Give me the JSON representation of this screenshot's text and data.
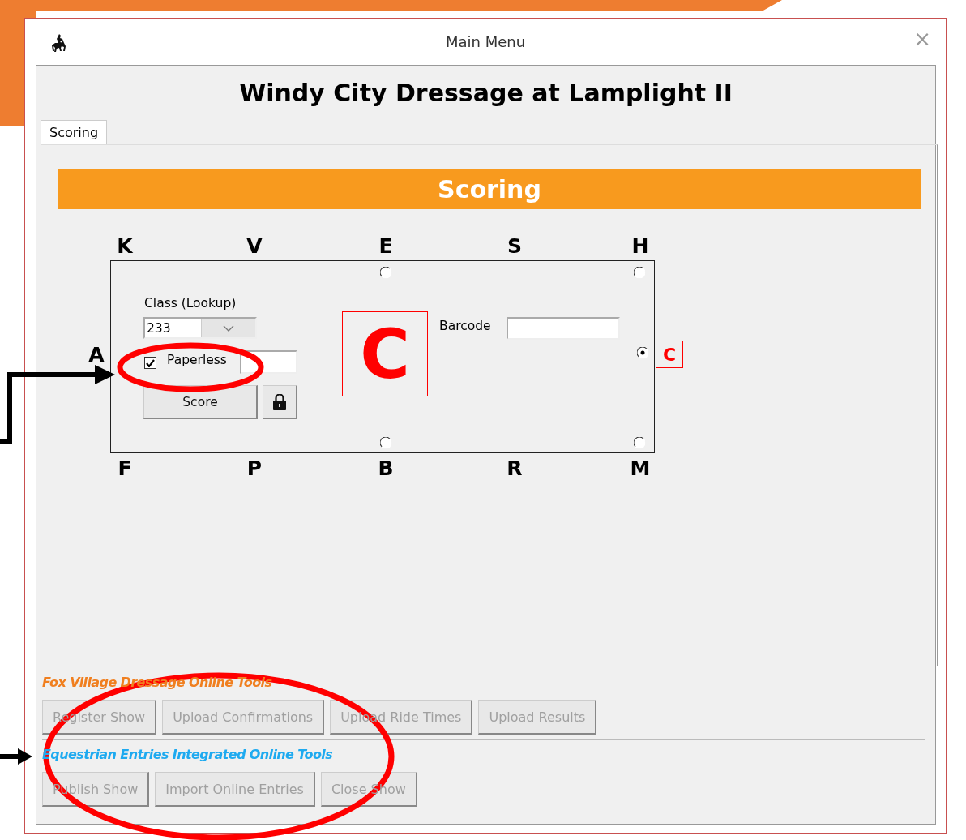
{
  "window": {
    "title": "Main Menu",
    "close": "×"
  },
  "heading": "Windy City Dressage at Lamplight II",
  "tabs": [
    {
      "label": "Scoring",
      "selected": true
    }
  ],
  "scoring": {
    "banner": "Scoring",
    "arena": {
      "top_letters": [
        "K",
        "V",
        "E",
        "S",
        "H"
      ],
      "side_letter": "A",
      "bottom_letters": [
        "F",
        "P",
        "B",
        "R",
        "M"
      ],
      "center_letter": "C",
      "radios": [
        {
          "selected": false
        },
        {
          "selected": false
        },
        {
          "selected": true,
          "label": "C"
        },
        {
          "selected": false
        },
        {
          "selected": false
        }
      ]
    },
    "class_label": "Class (Lookup)",
    "class_value": "233",
    "paperless": {
      "label": "Paperless",
      "checked": true
    },
    "score_button": "Score",
    "barcode_label": "Barcode"
  },
  "tool_sections": [
    {
      "title": "Fox Village Dressage Online Tools",
      "color": "#f07f1f",
      "buttons": [
        {
          "label": "Register Show",
          "disabled": true
        },
        {
          "label": "Upload Confirmations",
          "disabled": true
        },
        {
          "label": "Upload Ride Times",
          "disabled": true
        },
        {
          "label": "Upload Results",
          "disabled": true
        }
      ]
    },
    {
      "title": "Equestrian Entries Integrated Online Tools",
      "color": "#1eaaf0",
      "buttons": [
        {
          "label": "Publish Show",
          "disabled": true
        },
        {
          "label": "Import Online Entries",
          "disabled": true
        },
        {
          "label": "Close Show",
          "disabled": true
        }
      ]
    }
  ]
}
